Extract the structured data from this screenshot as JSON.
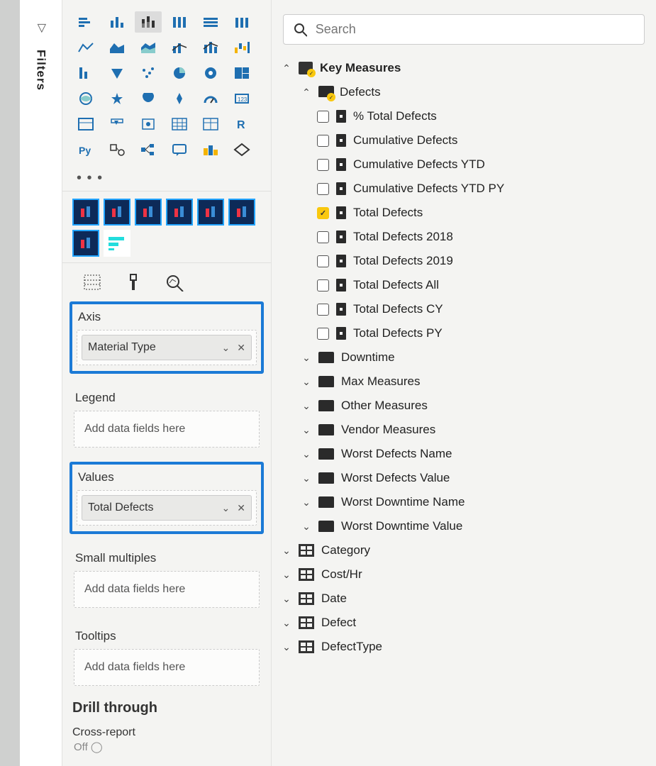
{
  "filtersRail": {
    "label": "Filters"
  },
  "search": {
    "placeholder": "Search"
  },
  "wells": {
    "axis": {
      "title": "Axis",
      "field": "Material Type"
    },
    "legend": {
      "title": "Legend",
      "placeholder": "Add data fields here"
    },
    "values": {
      "title": "Values",
      "field": "Total Defects"
    },
    "small": {
      "title": "Small multiples",
      "placeholder": "Add data fields here"
    },
    "tooltips": {
      "title": "Tooltips",
      "placeholder": "Add data fields here"
    },
    "drillTitle": "Drill through",
    "crossReport": "Cross-report",
    "offLabel": "Off"
  },
  "tree": {
    "keyMeasures": "Key Measures",
    "defects": "Defects",
    "defectItems": [
      {
        "label": "% Total Defects",
        "checked": false
      },
      {
        "label": "Cumulative Defects",
        "checked": false
      },
      {
        "label": "Cumulative Defects YTD",
        "checked": false
      },
      {
        "label": "Cumulative Defects YTD PY",
        "checked": false
      },
      {
        "label": "Total Defects",
        "checked": true
      },
      {
        "label": "Total Defects 2018",
        "checked": false
      },
      {
        "label": "Total Defects 2019",
        "checked": false
      },
      {
        "label": "Total Defects All",
        "checked": false
      },
      {
        "label": "Total Defects CY",
        "checked": false
      },
      {
        "label": "Total Defects PY",
        "checked": false
      }
    ],
    "folders": [
      "Downtime",
      "Max Measures",
      "Other Measures",
      "Vendor Measures",
      "Worst Defects Name",
      "Worst Defects Value",
      "Worst Downtime Name",
      "Worst Downtime Value"
    ],
    "tables": [
      "Category",
      "Cost/Hr",
      "Date",
      "Defect",
      "DefectType"
    ]
  }
}
